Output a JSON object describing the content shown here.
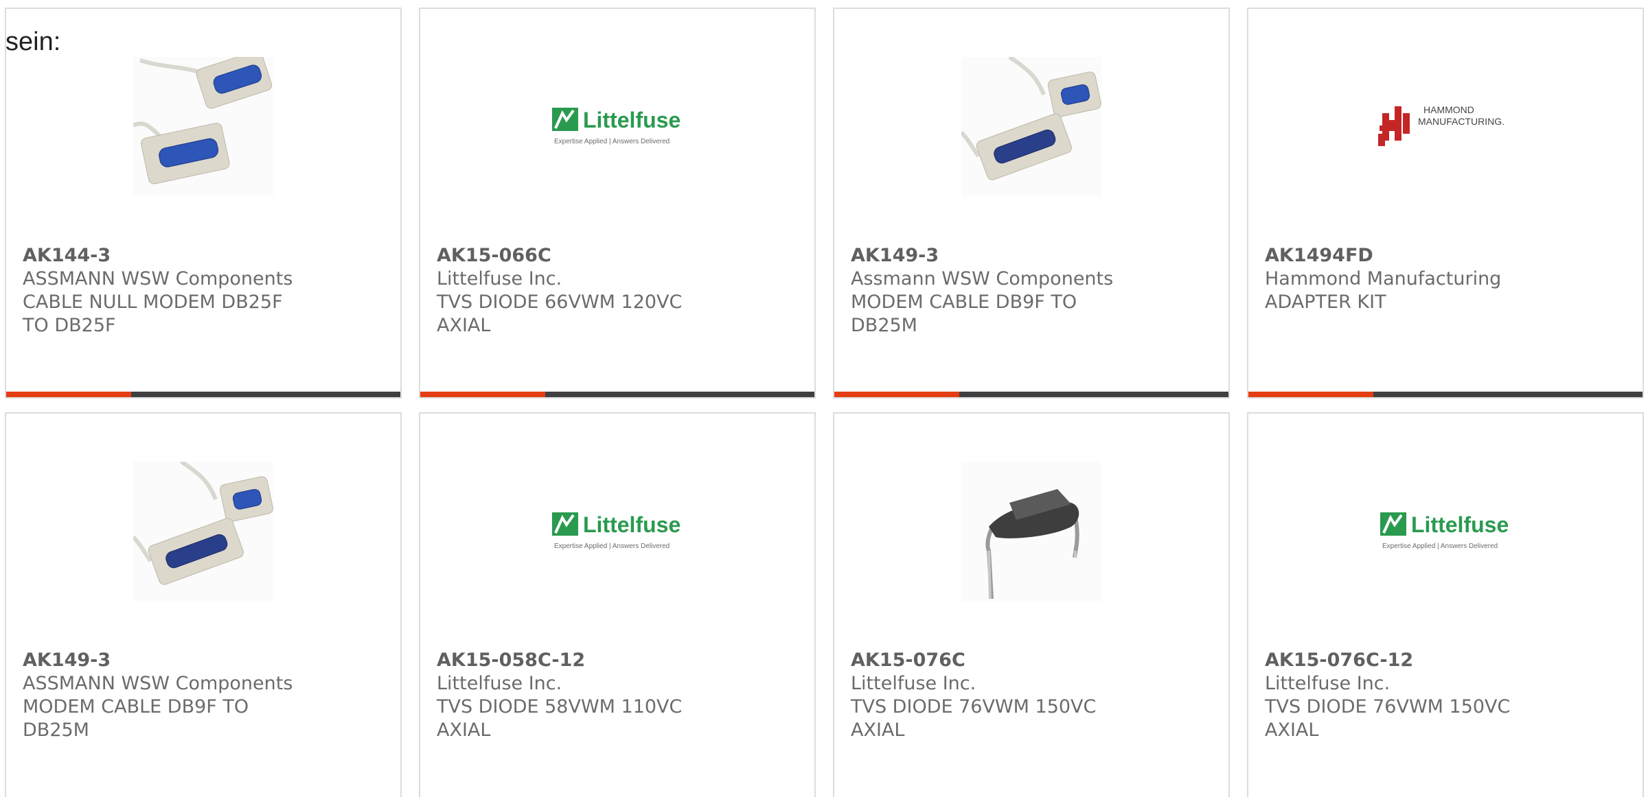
{
  "intro_text": "sein:",
  "colors": {
    "accent": "#e43d12",
    "bar": "#3e3f41",
    "text": "#6b6b6b"
  },
  "products": [
    {
      "part": "AK144-3",
      "manufacturer": "ASSMANN WSW Components",
      "description": "CABLE NULL MODEM DB25F TO DB25F",
      "image": "db25f-cable-icon"
    },
    {
      "part": "AK15-066C",
      "manufacturer": "Littelfuse Inc.",
      "description": "TVS DIODE 66VWM 120VC AXIAL",
      "image": "littelfuse-logo"
    },
    {
      "part": "AK149-3",
      "manufacturer": "Assmann WSW Components",
      "description": "MODEM CABLE DB9F TO DB25M",
      "image": "db9-db25-cable-icon"
    },
    {
      "part": "AK1494FD",
      "manufacturer": "Hammond Manufacturing",
      "description": "ADAPTER KIT",
      "image": "hammond-logo"
    },
    {
      "part": "AK149-3",
      "manufacturer": "ASSMANN WSW Components",
      "description": "MODEM CABLE DB9F TO DB25M",
      "image": "db9-db25-cable-icon"
    },
    {
      "part": "AK15-058C-12",
      "manufacturer": "Littelfuse Inc.",
      "description": "TVS DIODE 58VWM 110VC AXIAL",
      "image": "littelfuse-logo"
    },
    {
      "part": "AK15-076C",
      "manufacturer": "Littelfuse Inc.",
      "description": "TVS DIODE 76VWM 150VC AXIAL",
      "image": "tvs-diode-icon"
    },
    {
      "part": "AK15-076C-12",
      "manufacturer": "Littelfuse Inc.",
      "description": "TVS DIODE 76VWM 150VC AXIAL",
      "image": "littelfuse-logo"
    }
  ],
  "logos": {
    "littelfuse_name": "Littelfuse",
    "littelfuse_tagline": "Expertise Applied | Answers Delivered",
    "hammond_line1": "HAMMOND",
    "hammond_line2": "MANUFACTURING."
  }
}
